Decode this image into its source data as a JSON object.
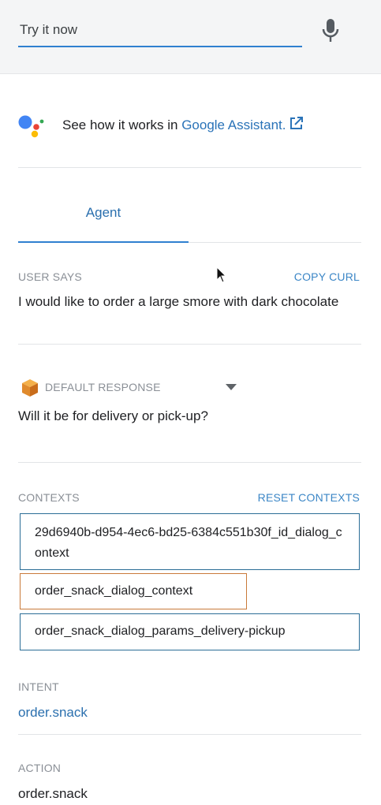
{
  "search": {
    "placeholder": "Try it now",
    "value": ""
  },
  "assistant_promo": {
    "prefix": "See how it works in",
    "link_label": "Google Assistant."
  },
  "tabs": [
    {
      "label": "Agent",
      "active": true
    }
  ],
  "user_says": {
    "label": "USER SAYS",
    "action": "COPY CURL",
    "text": "I would like to order a large smore with dark chocolate"
  },
  "default_response": {
    "label": "DEFAULT RESPONSE",
    "text": "Will it be for delivery or pick-up?"
  },
  "contexts": {
    "label": "CONTEXTS",
    "action": "RESET CONTEXTS",
    "items": [
      "29d6940b-d954-4ec6-bd25-6384c551b30f_id_dialog_context",
      "order_snack_dialog_context",
      "order_snack_dialog_params_delivery-pickup"
    ]
  },
  "intent": {
    "label": "INTENT",
    "value": "order.snack"
  },
  "action": {
    "label": "ACTION",
    "value": "order.snack"
  },
  "colors": {
    "accent": "#2f80d0",
    "link": "#2a73b8",
    "context_border": "#2b6d96",
    "context_highlight": "#c97a3a",
    "label_gray": "#8a8f96"
  },
  "icons": [
    "microphone-icon",
    "google-assistant-logo",
    "external-link-icon",
    "dialogflow-cube-icon",
    "caret-down-icon",
    "mouse-cursor"
  ]
}
